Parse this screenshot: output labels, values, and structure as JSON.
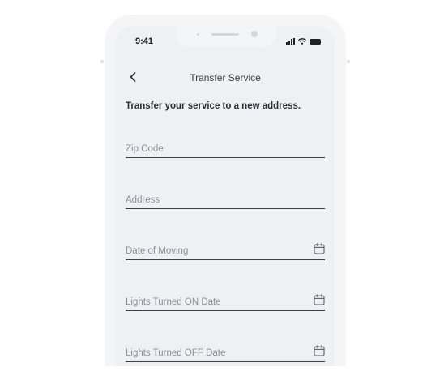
{
  "status_bar": {
    "time": "9:41"
  },
  "nav": {
    "title": "Transfer Service"
  },
  "intro": "Transfer your service to a new address.",
  "fields": [
    {
      "placeholder": "Zip Code",
      "value": ""
    },
    {
      "placeholder": "Address",
      "value": ""
    },
    {
      "placeholder": "Date of Moving",
      "value": "",
      "icon": "calendar-icon"
    },
    {
      "placeholder": "Lights Turned ON Date",
      "value": "",
      "icon": "calendar-icon"
    },
    {
      "placeholder": "Lights Turned OFF Date",
      "value": "",
      "icon": "calendar-icon"
    }
  ],
  "colors": {
    "screen_bg": "#eef1f4",
    "frame": "#f3f5f7",
    "text": "#2b2f33",
    "placeholder": "#8b9096"
  }
}
